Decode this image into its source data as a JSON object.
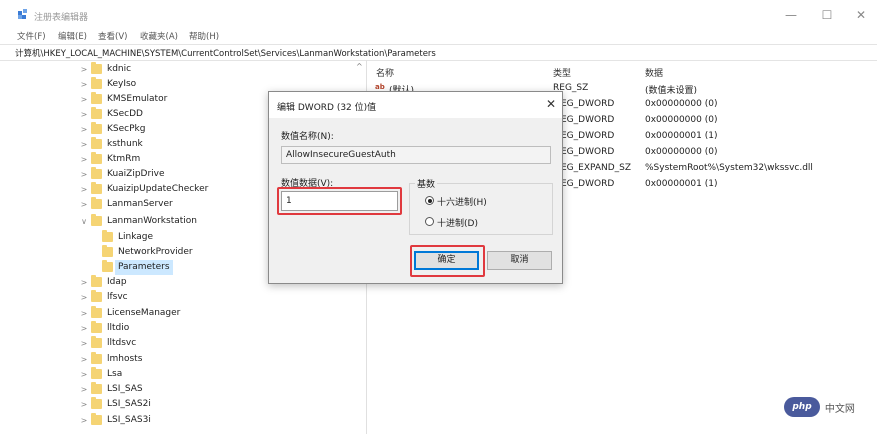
{
  "window": {
    "title": "注册表编辑器",
    "controls": {
      "minimize": "—",
      "maximize": "☐",
      "close": "✕"
    }
  },
  "menu": [
    "文件(F)",
    "编辑(E)",
    "查看(V)",
    "收藏夹(A)",
    "帮助(H)"
  ],
  "address": "计算机\\HKEY_LOCAL_MACHINE\\SYSTEM\\CurrentControlSet\\Services\\LanmanWorkstation\\Parameters",
  "tree": {
    "items": [
      {
        "label": "kdnic",
        "chevron": ">"
      },
      {
        "label": "KeyIso",
        "chevron": ">"
      },
      {
        "label": "KMSEmulator",
        "chevron": ">"
      },
      {
        "label": "KSecDD",
        "chevron": ">"
      },
      {
        "label": "KSecPkg",
        "chevron": ">"
      },
      {
        "label": "ksthunk",
        "chevron": ">"
      },
      {
        "label": "KtmRm",
        "chevron": ">"
      },
      {
        "label": "KuaiZipDrive",
        "chevron": ">"
      },
      {
        "label": "KuaizipUpdateChecker",
        "chevron": ">"
      },
      {
        "label": "LanmanServer",
        "chevron": ">"
      },
      {
        "label": "LanmanWorkstation",
        "chevron": "∨"
      },
      {
        "label": "Linkage",
        "chevron": ""
      },
      {
        "label": "NetworkProvider",
        "chevron": ""
      },
      {
        "label": "Parameters",
        "chevron": ""
      },
      {
        "label": "Idap",
        "chevron": ">"
      },
      {
        "label": "lfsvc",
        "chevron": ">"
      },
      {
        "label": "LicenseManager",
        "chevron": ">"
      },
      {
        "label": "lltdio",
        "chevron": ">"
      },
      {
        "label": "lltdsvc",
        "chevron": ">"
      },
      {
        "label": "lmhosts",
        "chevron": ">"
      },
      {
        "label": "Lsa",
        "chevron": ">"
      },
      {
        "label": "LSI_SAS",
        "chevron": ">"
      },
      {
        "label": "LSI_SAS2i",
        "chevron": ">"
      },
      {
        "label": "LSI_SAS3i",
        "chevron": ">"
      }
    ],
    "scroll_up": "^"
  },
  "list": {
    "headers": {
      "name": "名称",
      "type": "类型",
      "data": "数据"
    },
    "rows": [
      {
        "name": "(默认)",
        "type": "REG_SZ",
        "data": "(数值未设置)"
      },
      {
        "name": "",
        "type": "EG_DWORD",
        "data": "0x00000000 (0)"
      },
      {
        "name": "",
        "type": "EG_DWORD",
        "data": "0x00000000 (0)"
      },
      {
        "name": "",
        "type": "EG_DWORD",
        "data": "0x00000001 (1)"
      },
      {
        "name": "",
        "type": "EG_DWORD",
        "data": "0x00000000 (0)"
      },
      {
        "name": "",
        "type": "EG_EXPAND_SZ",
        "data": "%SystemRoot%\\System32\\wkssvc.dll"
      },
      {
        "name": "",
        "type": "EG_DWORD",
        "data": "0x00000001 (1)"
      }
    ],
    "string_icon": "ab"
  },
  "dialog": {
    "title": "编辑 DWORD (32 位)值",
    "close": "✕",
    "name_label": "数值名称(N):",
    "name_value": "AllowInsecureGuestAuth",
    "data_label": "数值数据(V):",
    "data_value": "1",
    "base_label": "基数",
    "hex_label": "十六进制(H)",
    "dec_label": "十进制(D)",
    "ok_label": "确定",
    "cancel_label": "取消"
  },
  "watermark": {
    "logo": "php",
    "text": "中文网"
  },
  "colors": {
    "highlight_red": "#e0393e",
    "folder": "#f5d474",
    "selection": "#cce8ff",
    "default_button": "#0078d7"
  }
}
